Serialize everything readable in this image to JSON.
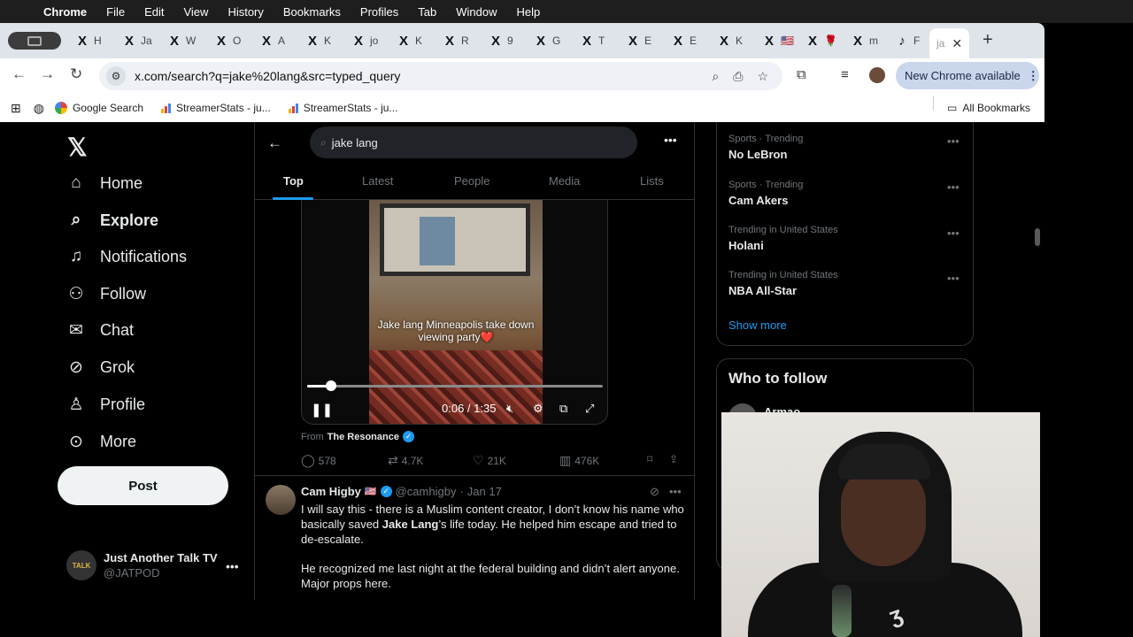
{
  "menubar": {
    "app": "Chrome",
    "items": [
      "File",
      "Edit",
      "View",
      "History",
      "Bookmarks",
      "Profiles",
      "Tab",
      "Window",
      "Help"
    ]
  },
  "tabs": [
    {
      "fav": "X",
      "label": "H"
    },
    {
      "fav": "X",
      "label": "Ja"
    },
    {
      "fav": "X",
      "label": "W"
    },
    {
      "fav": "X",
      "label": "O"
    },
    {
      "fav": "X",
      "label": "A"
    },
    {
      "fav": "X",
      "label": "K"
    },
    {
      "fav": "X",
      "label": "jo"
    },
    {
      "fav": "X",
      "label": "K"
    },
    {
      "fav": "X",
      "label": "R"
    },
    {
      "fav": "X",
      "label": "9"
    },
    {
      "fav": "X",
      "label": "G"
    },
    {
      "fav": "X",
      "label": "T"
    },
    {
      "fav": "X",
      "label": "E"
    },
    {
      "fav": "X",
      "label": "E"
    },
    {
      "fav": "X",
      "label": "K"
    },
    {
      "fav": "X",
      "label": "🇺🇸"
    },
    {
      "fav": "X",
      "label": "🌹"
    },
    {
      "fav": "X",
      "label": "m"
    },
    {
      "fav": "♪",
      "label": "F"
    }
  ],
  "active_tab": {
    "label": "ja",
    "close": "✕"
  },
  "omnibox": {
    "url": "x.com/search?q=jake%20lang&src=typed_query"
  },
  "new_chrome": "New Chrome available",
  "bookmarks": {
    "items": [
      "Google Search",
      "StreamerStats - ju...",
      "StreamerStats - ju..."
    ],
    "all": "All Bookmarks"
  },
  "nav": {
    "items": [
      "Home",
      "Explore",
      "Notifications",
      "Follow",
      "Chat",
      "Grok",
      "Profile",
      "More"
    ],
    "post": "Post"
  },
  "account": {
    "name": "Just Another Talk TV",
    "handle": "@JATPOD",
    "avatar_text": "TALK"
  },
  "search": {
    "query": "jake lang"
  },
  "search_tabs": [
    "Top",
    "Latest",
    "People",
    "Media",
    "Lists"
  ],
  "video": {
    "caption": "Jake lang Minneapolis take down viewing party❤️",
    "time": "0:06 / 1:35",
    "progress": 0.08,
    "from_prefix": "From",
    "from_source": "The Resonance"
  },
  "post_actions": {
    "replies": "578",
    "reposts": "4.7K",
    "likes": "21K",
    "views": "476K"
  },
  "tweet": {
    "name": "Cam Higby",
    "flag": "🇺🇸",
    "handle": "@camhigby",
    "date": "Jan 17",
    "p1_a": "I will say this - there is a Muslim content creator, I don’t know his name who basically saved ",
    "p1_bold": "Jake Lang",
    "p1_b": "’s life today. He helped him escape and tried to de-escalate.",
    "p2": "He recognized me last night at the federal building and didn’t alert anyone. Major props here."
  },
  "trends": [
    {
      "category": "Sports · Trending",
      "title": "No LeBron"
    },
    {
      "category": "Sports · Trending",
      "title": "Cam Akers"
    },
    {
      "category": "Trending in United States",
      "title": "Holani"
    },
    {
      "category": "Trending in United States",
      "title": "NBA All-Star"
    }
  ],
  "show_more": "Show more",
  "who_to_follow": {
    "title": "Who to follow",
    "first": "Armao"
  },
  "colors": {
    "accent": "#1d9bf0",
    "background": "#000000",
    "text": "#e7e9ea",
    "muted": "#71767b"
  }
}
